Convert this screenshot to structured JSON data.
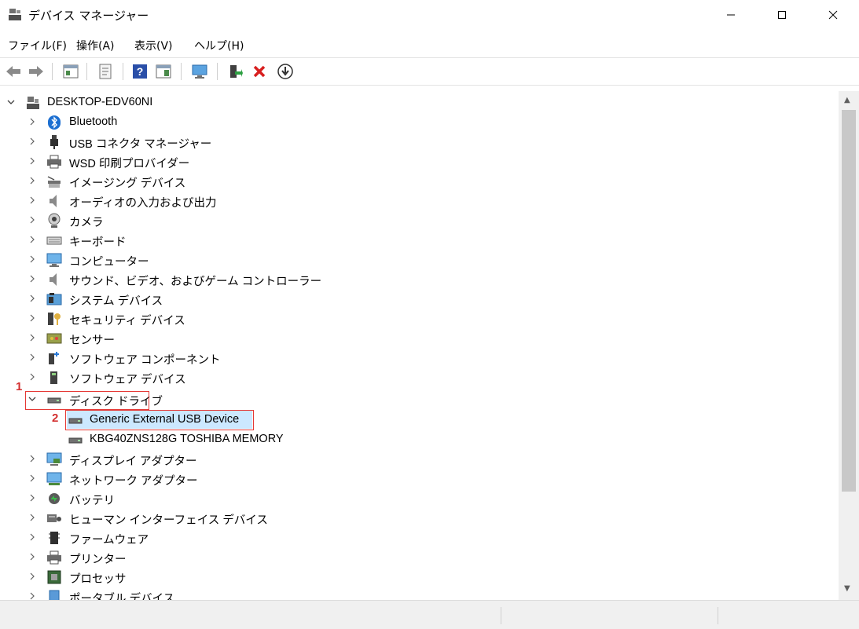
{
  "window": {
    "title": "デバイス マネージャー",
    "controls": [
      "minimize",
      "maximize",
      "close"
    ]
  },
  "menu": [
    {
      "label": "ファイル(F)"
    },
    {
      "label": "操作(A)"
    },
    {
      "label": "表示(V)"
    },
    {
      "label": "ヘルプ(H)"
    }
  ],
  "toolbar": [
    "back-arrow-icon",
    "forward-arrow-icon",
    "show-hide-tree-icon",
    "properties-icon",
    "help-icon",
    "action-pane-icon",
    "scan-hardware-icon",
    "update-driver-icon",
    "uninstall-icon",
    "download-icon"
  ],
  "tree": {
    "root": "DESKTOP-EDV60NI",
    "categories": [
      {
        "label": "Bluetooth",
        "icon": "bluetooth-icon"
      },
      {
        "label": "USB コネクタ マネージャー",
        "icon": "usb-icon"
      },
      {
        "label": "WSD 印刷プロバイダー",
        "icon": "printer-icon"
      },
      {
        "label": "イメージング デバイス",
        "icon": "scanner-icon"
      },
      {
        "label": "オーディオの入力および出力",
        "icon": "speaker-icon"
      },
      {
        "label": "カメラ",
        "icon": "camera-icon"
      },
      {
        "label": "キーボード",
        "icon": "keyboard-icon"
      },
      {
        "label": "コンピューター",
        "icon": "monitor-icon"
      },
      {
        "label": "サウンド、ビデオ、およびゲーム コントローラー",
        "icon": "speaker-icon"
      },
      {
        "label": "システム デバイス",
        "icon": "system-folder-icon"
      },
      {
        "label": "セキュリティ デバイス",
        "icon": "security-key-icon"
      },
      {
        "label": "センサー",
        "icon": "sensor-icon"
      },
      {
        "label": "ソフトウェア コンポーネント",
        "icon": "software-component-icon"
      },
      {
        "label": "ソフトウェア デバイス",
        "icon": "software-device-icon"
      },
      {
        "label": "ディスク ドライブ",
        "icon": "disk-drive-icon",
        "expanded": true,
        "children": [
          {
            "label": "Generic External USB Device",
            "icon": "disk-drive-icon",
            "selected": true
          },
          {
            "label": "KBG40ZNS128G TOSHIBA MEMORY",
            "icon": "disk-drive-icon"
          }
        ]
      },
      {
        "label": "ディスプレイ アダプター",
        "icon": "display-adapter-icon"
      },
      {
        "label": "ネットワーク アダプター",
        "icon": "network-icon"
      },
      {
        "label": "バッテリ",
        "icon": "battery-icon"
      },
      {
        "label": "ヒューマン インターフェイス デバイス",
        "icon": "hid-icon"
      },
      {
        "label": "ファームウェア",
        "icon": "firmware-icon"
      },
      {
        "label": "プリンター",
        "icon": "printer-icon"
      },
      {
        "label": "プロセッサ",
        "icon": "processor-icon"
      },
      {
        "label": "ポータブル デバイス",
        "icon": "portable-device-icon"
      }
    ]
  },
  "annotations": [
    {
      "number": "1",
      "target": "ディスク ドライブ"
    },
    {
      "number": "2",
      "target": "Generic External USB Device"
    }
  ],
  "colors": {
    "highlight": "#e53935",
    "selection": "#cce8ff"
  }
}
